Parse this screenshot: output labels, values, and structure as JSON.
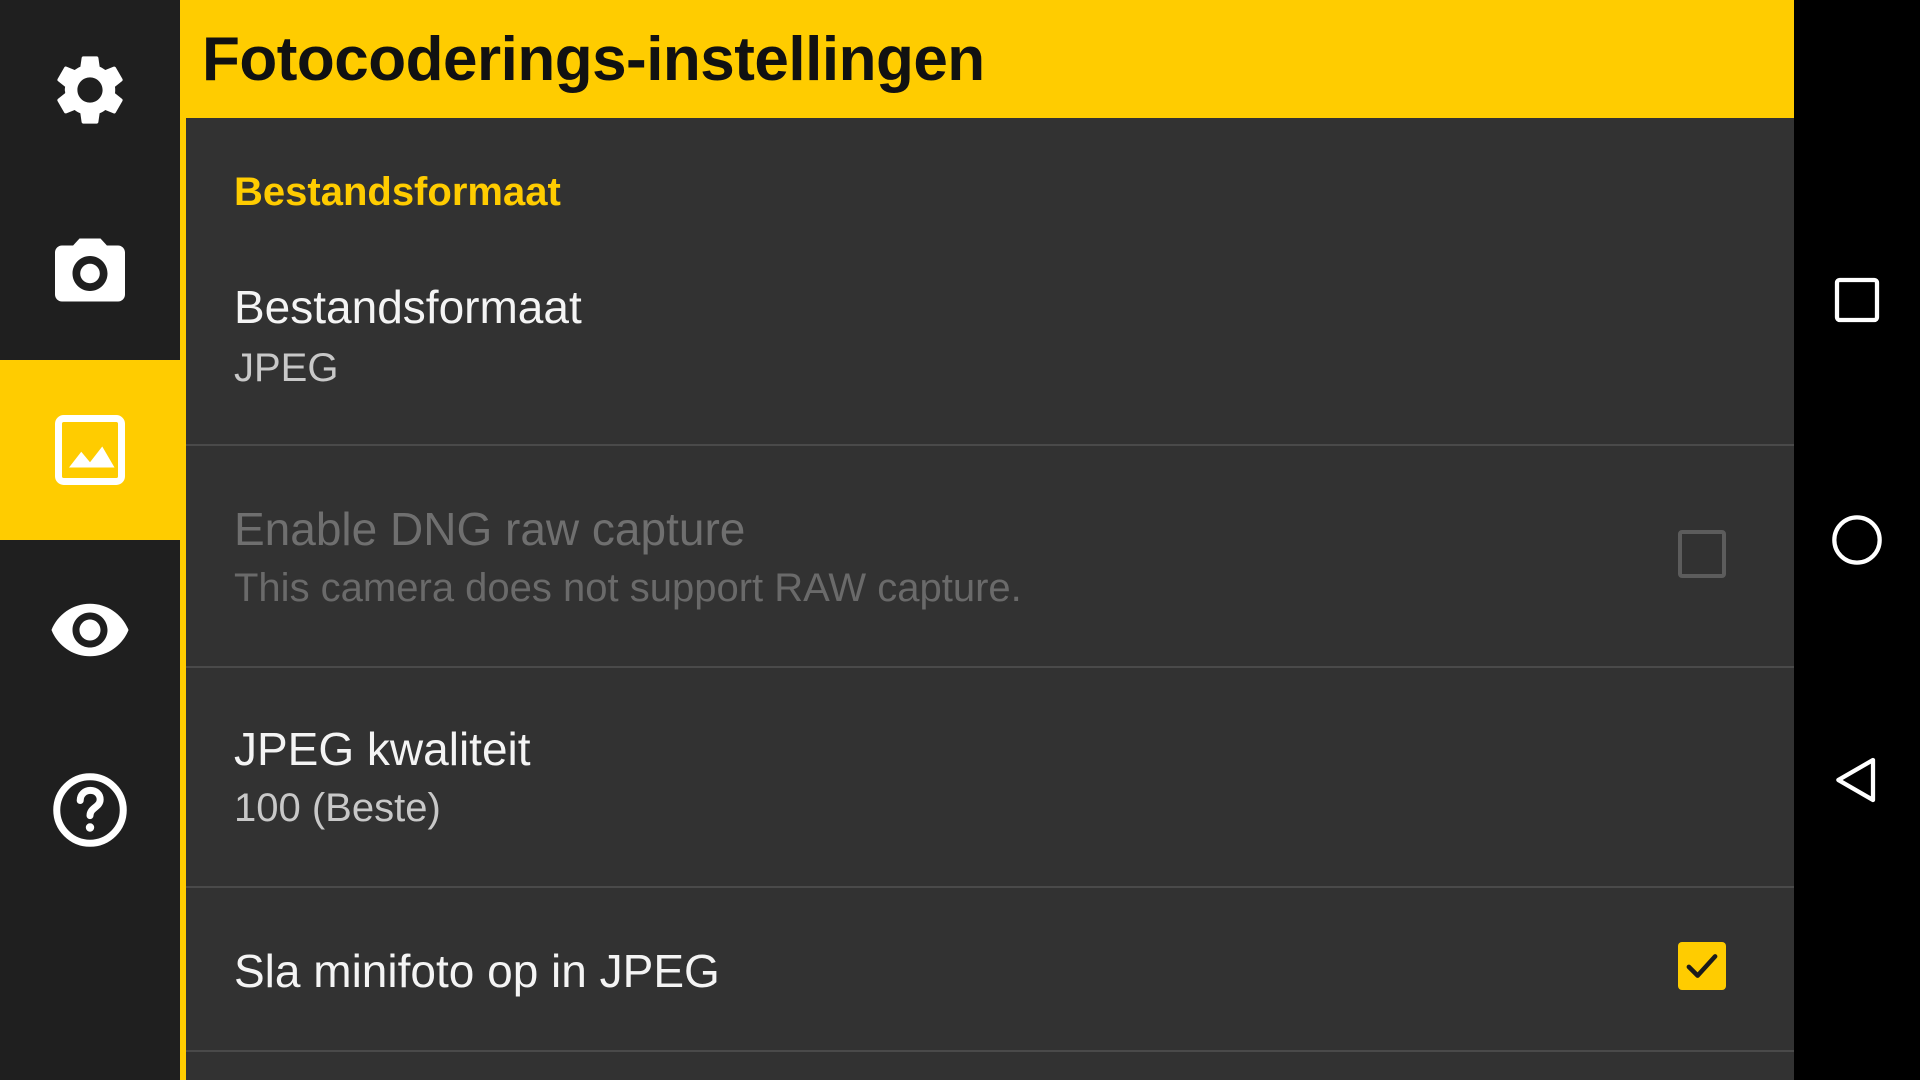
{
  "header": {
    "title": "Fotocoderings-instellingen"
  },
  "sidebar": {
    "items": [
      {
        "icon": "gear-icon",
        "active": false
      },
      {
        "icon": "camera-icon",
        "active": false
      },
      {
        "icon": "image-icon",
        "active": true
      },
      {
        "icon": "eye-icon",
        "active": false
      },
      {
        "icon": "help-icon",
        "active": false
      }
    ]
  },
  "section": {
    "title": "Bestandsformaat"
  },
  "prefs": {
    "file_format": {
      "title": "Bestandsformaat",
      "summary": "JPEG"
    },
    "dng_raw": {
      "title": "Enable DNG raw capture",
      "summary": "This camera does not support RAW capture.",
      "checked": false,
      "enabled": false
    },
    "jpeg_quality": {
      "title": "JPEG kwaliteit",
      "summary": "100 (Beste)"
    },
    "thumbnail": {
      "title": "Sla minifoto op in JPEG",
      "checked": true
    }
  },
  "navbar": {
    "buttons": [
      "recents-icon",
      "home-icon",
      "back-icon"
    ]
  },
  "colors": {
    "accent": "#ffcc00",
    "background": "#323232",
    "sidebar": "#1f1f1f"
  }
}
